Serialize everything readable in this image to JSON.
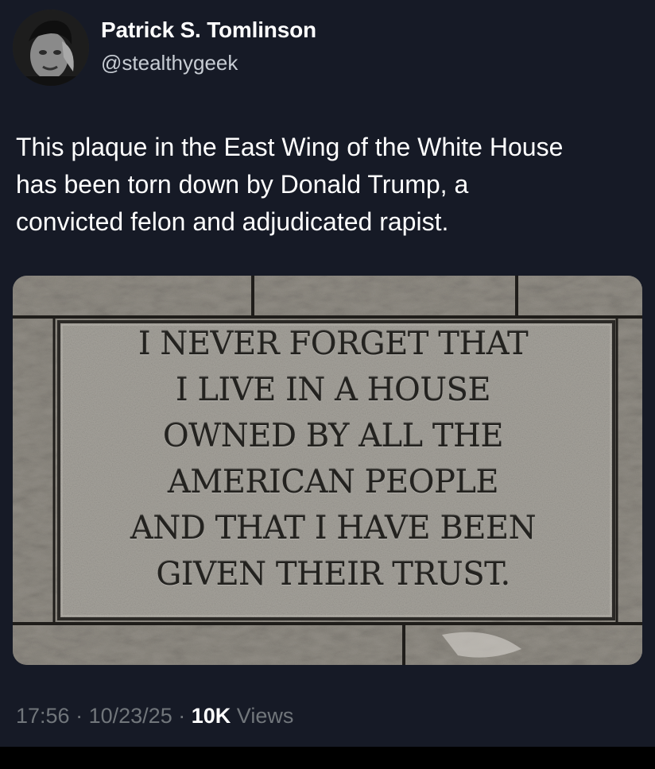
{
  "author": {
    "display_name": "Patrick S. Tomlinson",
    "handle": "@stealthygeek"
  },
  "tweet": {
    "text": "This plaque in the East Wing of the White House\nhas been torn down by Donald Trump, a\nconvicted felon and adjudicated rapist."
  },
  "media": {
    "plaque_lines": [
      "I NEVER FORGET THAT",
      "I LIVE IN A HOUSE",
      "OWNED BY ALL THE",
      "AMERICAN PEOPLE",
      "AND THAT I HAVE BEEN",
      "GIVEN THEIR TRUST."
    ]
  },
  "meta": {
    "time": "17:56",
    "separator": "·",
    "date": "10/23/25",
    "views_count": "10K",
    "views_label": "Views"
  },
  "colors": {
    "background": "#161a26",
    "text_primary": "#ffffff",
    "text_secondary": "#71767b"
  }
}
